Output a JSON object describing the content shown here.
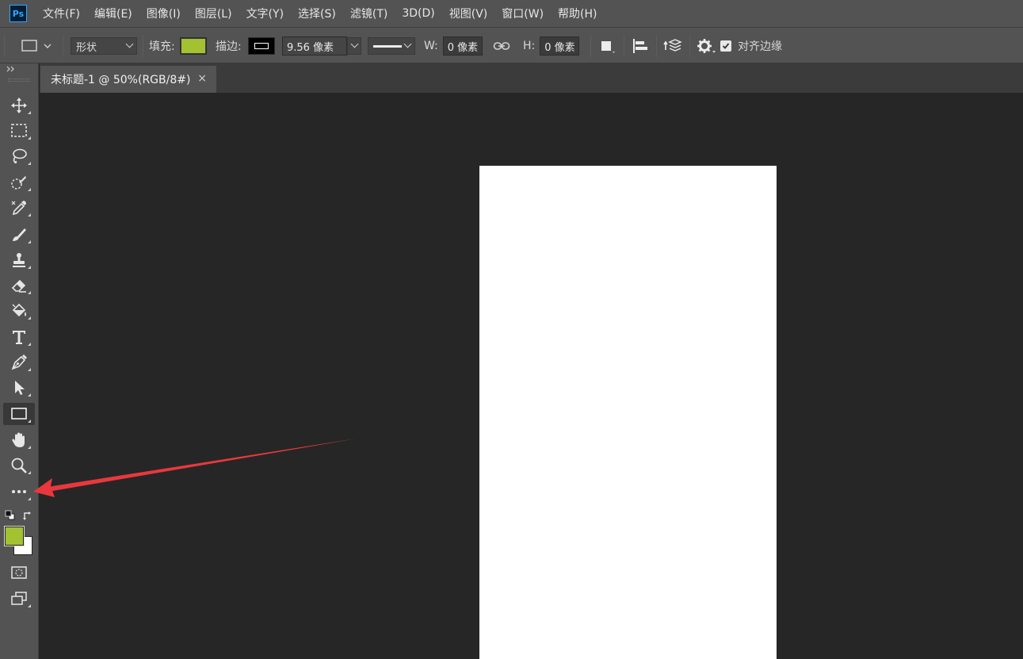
{
  "app": {
    "logo": "Ps"
  },
  "menu": [
    "文件(F)",
    "编辑(E)",
    "图像(I)",
    "图层(L)",
    "文字(Y)",
    "选择(S)",
    "滤镜(T)",
    "3D(D)",
    "视图(V)",
    "窗口(W)",
    "帮助(H)"
  ],
  "options": {
    "mode_value": "形状",
    "fill_label": "填充:",
    "fill_color": "#a3c130",
    "stroke_label": "描边:",
    "stroke_width": "9.56 像素",
    "w_label": "W:",
    "w_value": "0 像素",
    "h_label": "H:",
    "h_value": "0 像素",
    "align_edges_label": "对齐边缘"
  },
  "document": {
    "tab_title": "未标题-1 @ 50%(RGB/8#)",
    "close_glyph": "×"
  },
  "tools": [
    "move-icon",
    "marquee-icon",
    "lasso-icon",
    "quick-select-icon",
    "eyedropper-icon",
    "brush-icon",
    "stamp-icon",
    "eraser-icon",
    "paint-bucket-icon",
    "type-icon",
    "pen-icon",
    "path-select-icon",
    "rectangle-icon",
    "hand-icon",
    "zoom-icon",
    "more-tools-icon"
  ],
  "colors": {
    "foreground": "#a3c130",
    "background": "#ffffff",
    "annotation_arrow": "#e8383d"
  }
}
